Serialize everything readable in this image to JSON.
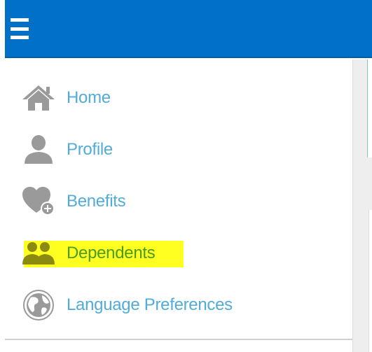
{
  "header": {
    "menu_icon": "hamburger-menu-icon",
    "background_color": "#0070c9"
  },
  "nav": {
    "items": [
      {
        "label": "Home",
        "icon": "home-icon"
      },
      {
        "label": "Profile",
        "icon": "user-icon"
      },
      {
        "label": "Benefits",
        "icon": "heart-plus-icon"
      },
      {
        "label": "Dependents",
        "icon": "users-icon",
        "highlighted": true
      },
      {
        "label": "Language Preferences",
        "icon": "globe-icon"
      }
    ],
    "label_color": "#52acd9",
    "highlight_color": "#ffff22",
    "highlighted_label_color": "#4d9b1f"
  }
}
